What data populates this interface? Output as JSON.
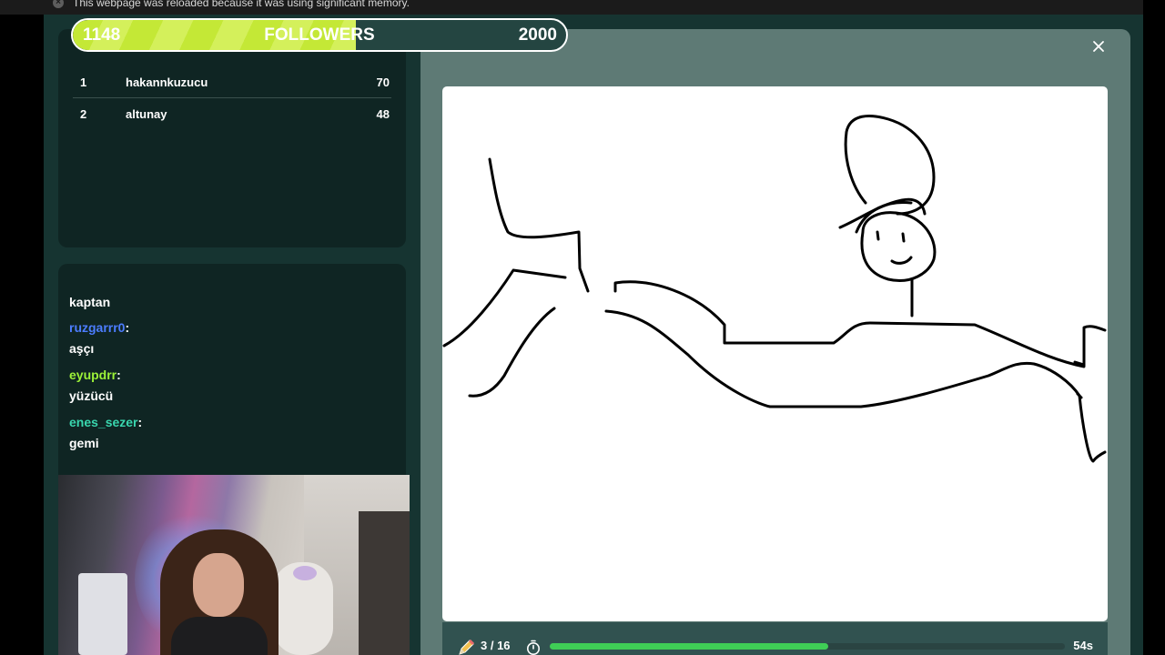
{
  "banner": {
    "message": "This webpage was reloaded because it was using significant memory."
  },
  "goal": {
    "current": "1148",
    "label": "FOLLOWERS",
    "target": "2000",
    "progress_fraction": 0.574
  },
  "leaderboard": [
    {
      "rank": "1",
      "name": "hakannkuzucu",
      "score": "70"
    },
    {
      "rank": "2",
      "name": "altunay",
      "score": "48"
    }
  ],
  "chat": {
    "first_message": "kaptan",
    "messages": [
      {
        "user": "ruzgarrr0",
        "sep": ":",
        "text": "aşçı",
        "color": "#4c7dff"
      },
      {
        "user": "eyupdrr",
        "sep": ":",
        "text": "yüzücü",
        "color": "#9cf238"
      },
      {
        "user": "enes_sezer",
        "sep": ":",
        "text": "gemi",
        "color": "#39d6ae"
      }
    ]
  },
  "game": {
    "round": "3 / 16",
    "time_left": "54s",
    "timer_fraction": 0.54,
    "icons": [
      "speaker-icon",
      "close-icon",
      "pencil-icon",
      "stopwatch-icon"
    ]
  },
  "colors": {
    "background": "#163431",
    "panel": "#0f2523",
    "game_panel": "#5e7a75",
    "progress": "#3fce56",
    "goal_fill": "#c4e836"
  }
}
